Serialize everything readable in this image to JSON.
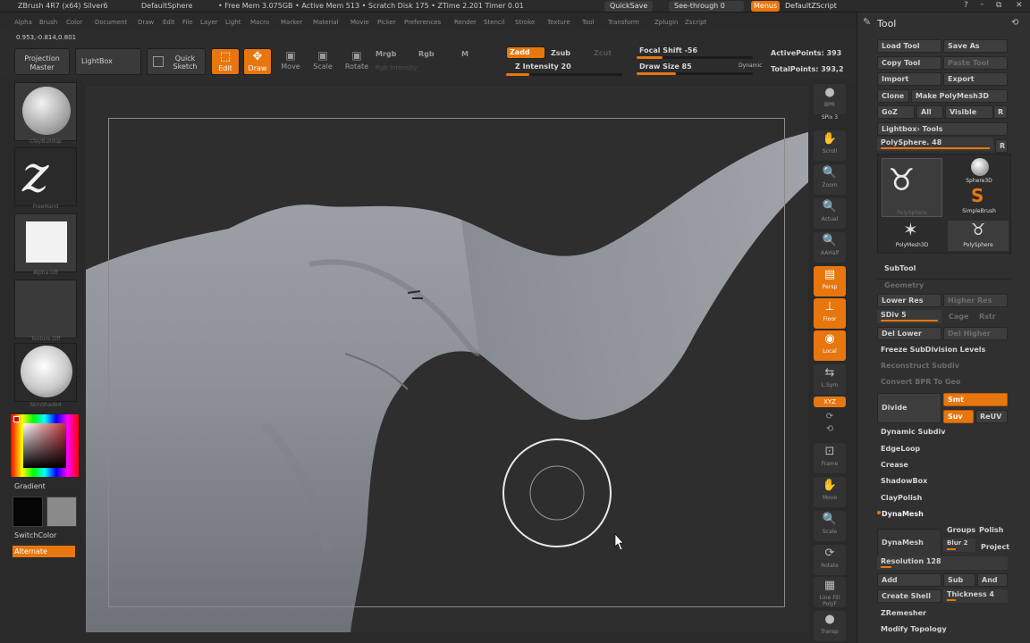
{
  "title": {
    "app": "ZBrush 4R7 (x64) Silver6",
    "doc": "DefaultSphere",
    "stats": "• Free Mem 3.075GB • Active Mem 513 • Scratch Disk 175 • ZTime 2.201 Timer 0.01",
    "quicksave": "QuickSave",
    "seethrough": "See-through  0",
    "menus": "Menus",
    "script": "DefaultZScript"
  },
  "menu": [
    "Alpha",
    "Brush",
    "Color",
    "Document",
    "Draw",
    "Edit",
    "File",
    "Layer",
    "Light",
    "Macro",
    "Marker",
    "Material",
    "Movie",
    "Picker",
    "Preferences",
    "Render",
    "Stencil",
    "Stroke",
    "Texture",
    "Tool",
    "Transform",
    "Zplugin",
    "Zscript"
  ],
  "coords": "0.953,-0.814,0.801",
  "toolbar": {
    "projection_master": "Projection Master",
    "lightbox": "LightBox",
    "quick_sketch": "Quick Sketch",
    "edit": "Edit",
    "draw": "Draw",
    "move": "Move",
    "scale": "Scale",
    "rotate": "Rotate",
    "mrgb": "Mrgb",
    "rgb": "Rgb",
    "m": "M",
    "rgb_intensity": "Rgb Intensity",
    "zadd": "Zadd",
    "zsub": "Zsub",
    "zcut": "Zcut",
    "z_intensity": "Z Intensity 20",
    "z_intensity_value": 20,
    "focal_shift": "Focal Shift -56",
    "focal_shift_value": -56,
    "draw_size": "Draw Size 85",
    "draw_size_value": 85,
    "dynamic": "Dynamic",
    "active_points": "ActivePoints: 393",
    "total_points": "TotalPoints: 393,2"
  },
  "left": {
    "brush_label": "ClayBuildup",
    "stroke_label": "FreeHand",
    "alpha_label": "Alpha Off",
    "texture_label": "Texture Off",
    "material_label": "SkinShade4",
    "gradient": "Gradient",
    "switchcolor": "SwitchColor",
    "alternate": "Alternate"
  },
  "rightshelf": [
    {
      "id": "bpr",
      "label": "BPR",
      "glyph": "●"
    },
    {
      "id": "spix",
      "label": "SPix 3",
      "glyph": ""
    },
    {
      "id": "scroll",
      "label": "Scroll",
      "glyph": "✋"
    },
    {
      "id": "zoom",
      "label": "Zoom",
      "glyph": "🔍"
    },
    {
      "id": "actual",
      "label": "Actual",
      "glyph": "🔍"
    },
    {
      "id": "aahalf",
      "label": "AAHalf",
      "glyph": "🔍"
    },
    {
      "id": "persp",
      "label": "Persp",
      "glyph": "▤"
    },
    {
      "id": "floor",
      "label": "Floor",
      "glyph": "⊥"
    },
    {
      "id": "local",
      "label": "Local",
      "glyph": "◉"
    },
    {
      "id": "lsym",
      "label": "L.Sym",
      "glyph": "⇆"
    },
    {
      "id": "xyz",
      "label": "XYZ",
      "glyph": ""
    },
    {
      "id": "frame",
      "label": "Frame",
      "glyph": "⊡"
    },
    {
      "id": "move",
      "label": "Move",
      "glyph": "✋"
    },
    {
      "id": "scale",
      "label": "Scale",
      "glyph": "🔍"
    },
    {
      "id": "rotate",
      "label": "Rotate",
      "glyph": "⟳"
    },
    {
      "id": "linefill",
      "label": "Line Fill PolyF",
      "glyph": "▦"
    },
    {
      "id": "transp",
      "label": "Transp",
      "glyph": "●"
    }
  ],
  "tool": {
    "header": "Tool",
    "load_tool": "Load Tool",
    "save_as": "Save As",
    "copy_tool": "Copy Tool",
    "paste_tool": "Paste Tool",
    "import": "Import",
    "export": "Export",
    "clone": "Clone",
    "make_polymesh": "Make PolyMesh3D",
    "goz": "GoZ",
    "all": "All",
    "visible": "Visible",
    "r": "R",
    "lightbox_tools": "Lightbox› Tools",
    "polysphere_slider": "PolySphere. 48",
    "thumbs": [
      "PolySphere",
      "Sphere3D",
      "SimpleBrush",
      "PolyMesh3D",
      "PolySphere"
    ],
    "subtool": "SubTool",
    "geometry": "Geometry",
    "lower_res": "Lower Res",
    "higher_res": "Higher Res",
    "sdiv": "SDiv 5",
    "cage": "Cage",
    "rstr": "Rstr",
    "del_lower": "Del Lower",
    "del_higher": "Del Higher",
    "freeze": "Freeze SubDivision Levels",
    "reconstruct": "Reconstruct Subdiv",
    "convert_bpr": "Convert BPR To Geo",
    "divide": "Divide",
    "smt": "Smt",
    "suv": "Suv",
    "reuv": "ReUV",
    "dynamic_subdiv": "Dynamic Subdiv",
    "edgeloop": "EdgeLoop",
    "crease": "Crease",
    "shadowbox": "ShadowBox",
    "claypolish": "ClayPolish",
    "dynamesh_section": "DynaMesh",
    "dynamesh_btn": "DynaMesh",
    "groups": "Groups",
    "polish": "Polish",
    "blur": "Blur 2",
    "project": "Project",
    "resolution": "Resolution 128",
    "add": "Add",
    "sub": "Sub",
    "and": "And",
    "create_shell": "Create Shell",
    "thickness": "Thickness 4",
    "zremesher": "ZRemesher",
    "modify_topology": "Modify Topology"
  },
  "colors": {
    "accent": "#e8760f",
    "panel": "#303030",
    "canvas": "#2e2e2e",
    "mesh": "#8f9399"
  }
}
